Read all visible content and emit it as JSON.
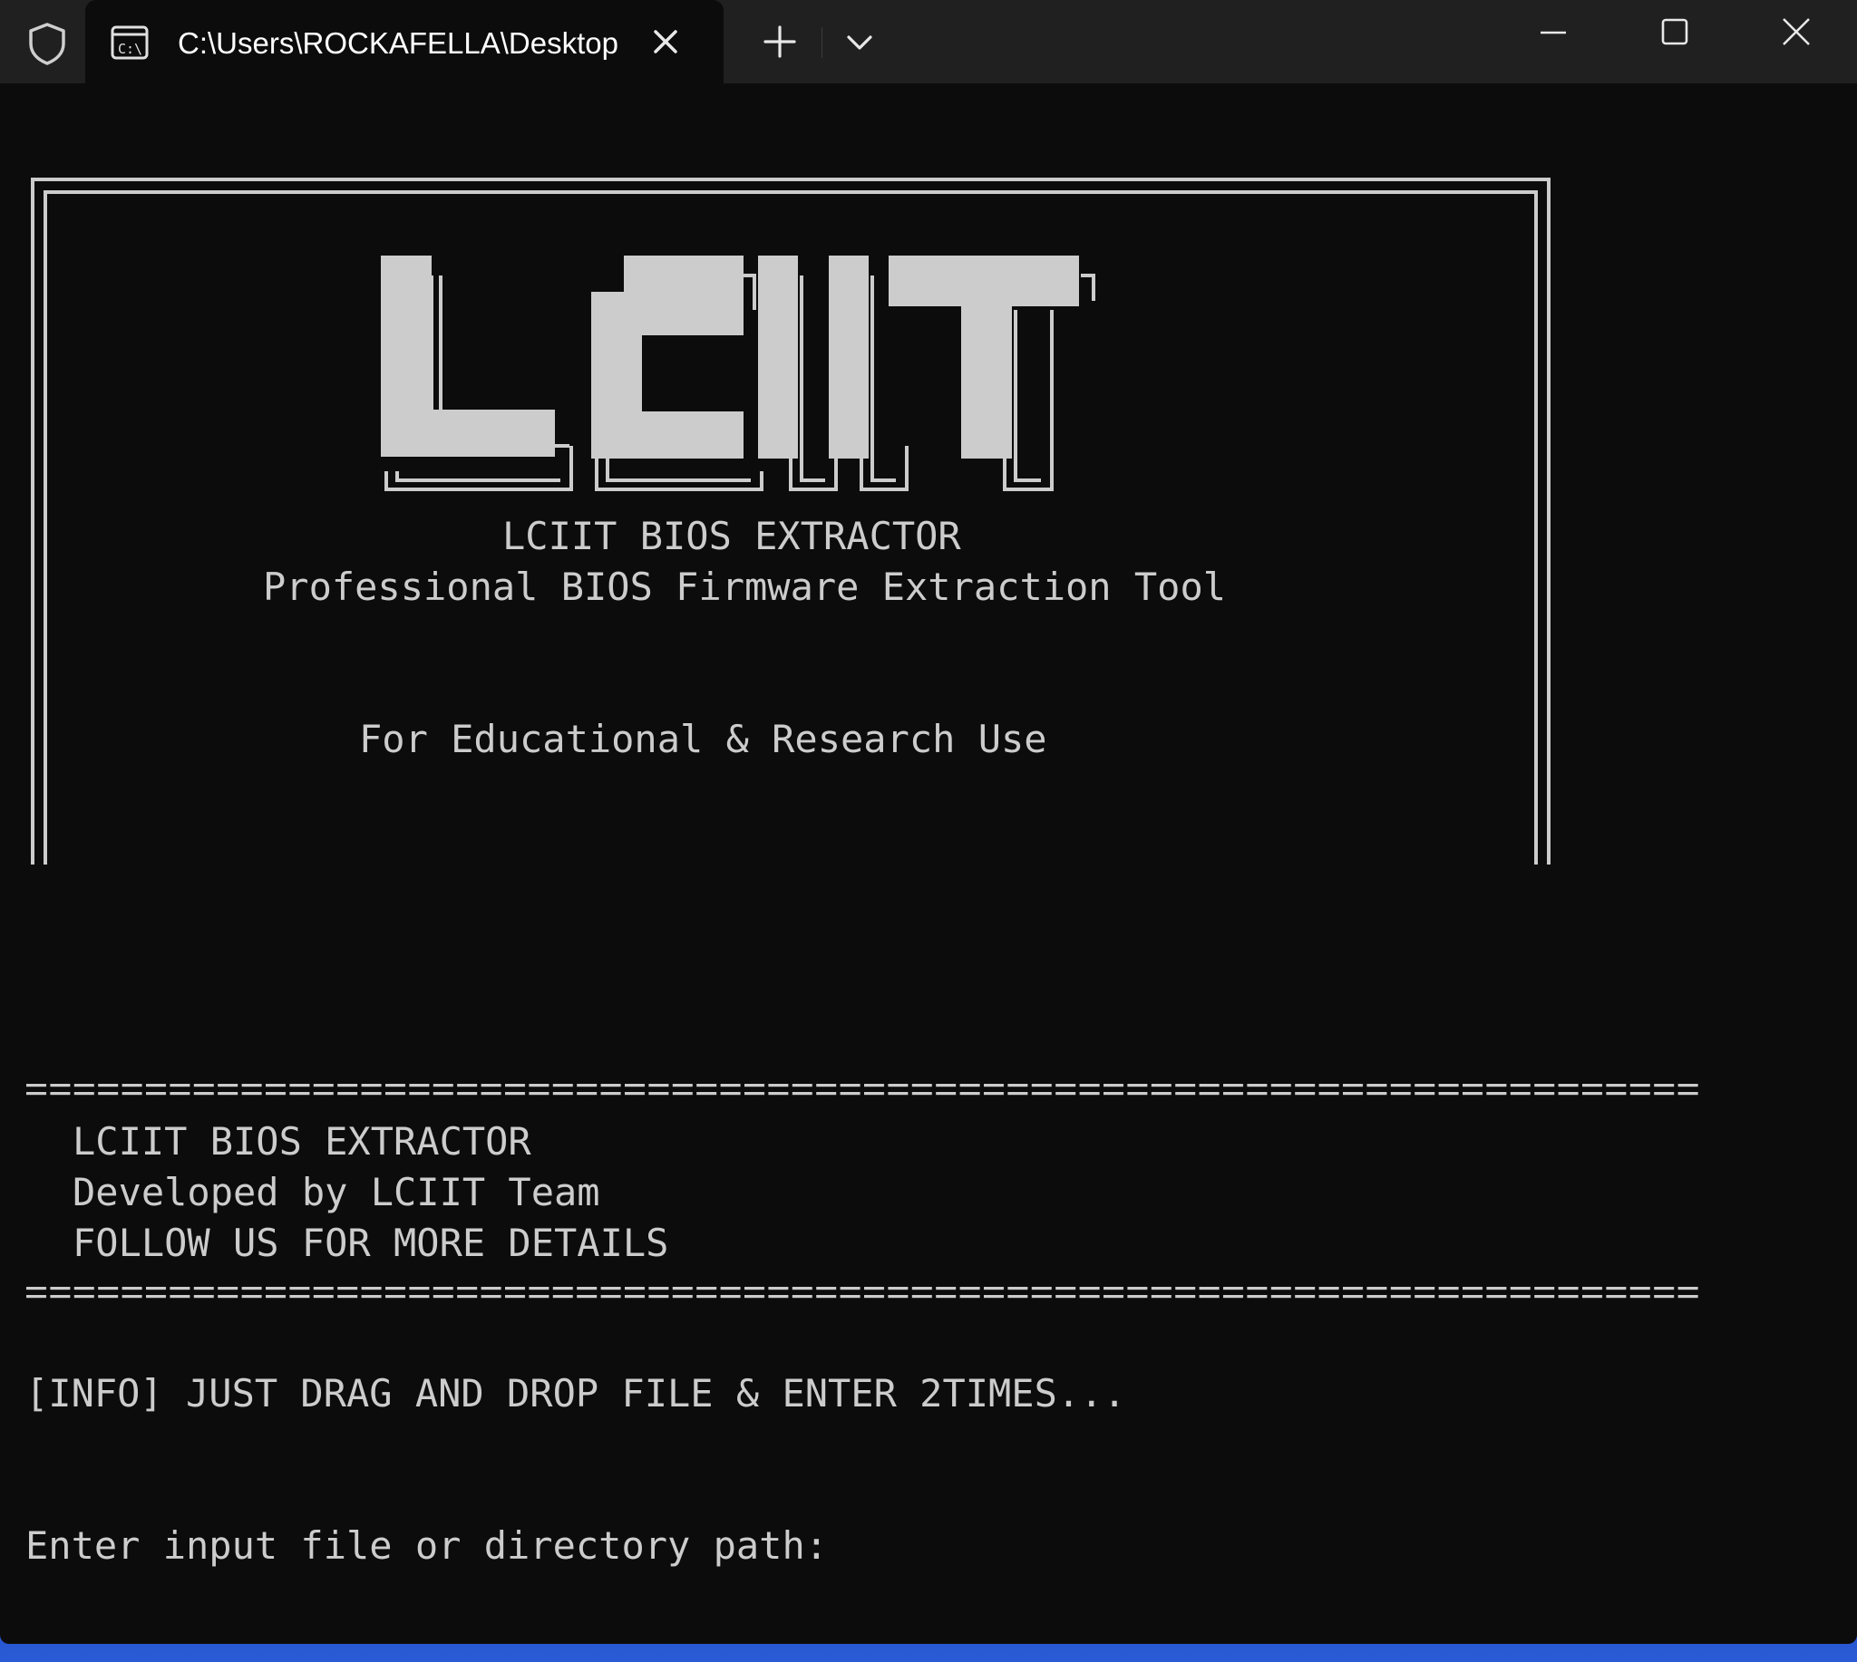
{
  "window": {
    "tab_title": "C:\\Users\\ROCKAFELLA\\Desktop"
  },
  "icons": {
    "shield": "shield-icon",
    "tab": "terminal-icon",
    "close_tab": "close-icon",
    "new_tab": "plus-icon",
    "dropdown": "chevron-down-icon",
    "minimize": "minimize-icon",
    "maximize": "maximize-icon",
    "close_window": "close-icon"
  },
  "banner": {
    "logo_text": "LCIIT",
    "title": "LCIIT BIOS EXTRACTOR",
    "subtitle": "Professional BIOS Firmware Extraction Tool",
    "notice": "For Educational & Research Use"
  },
  "info_block": {
    "line1": "LCIIT BIOS EXTRACTOR",
    "line2": "Developed by LCIIT Team",
    "line3": "FOLLOW US FOR MORE DETAILS"
  },
  "messages": {
    "info": "[INFO] JUST DRAG AND DROP FILE & ENTER 2TIMES...",
    "prompt": "Enter input file or directory path:"
  },
  "colors": {
    "terminal_bg": "#0c0c0c",
    "titlebar_bg": "#202020",
    "text": "#cccccc"
  }
}
